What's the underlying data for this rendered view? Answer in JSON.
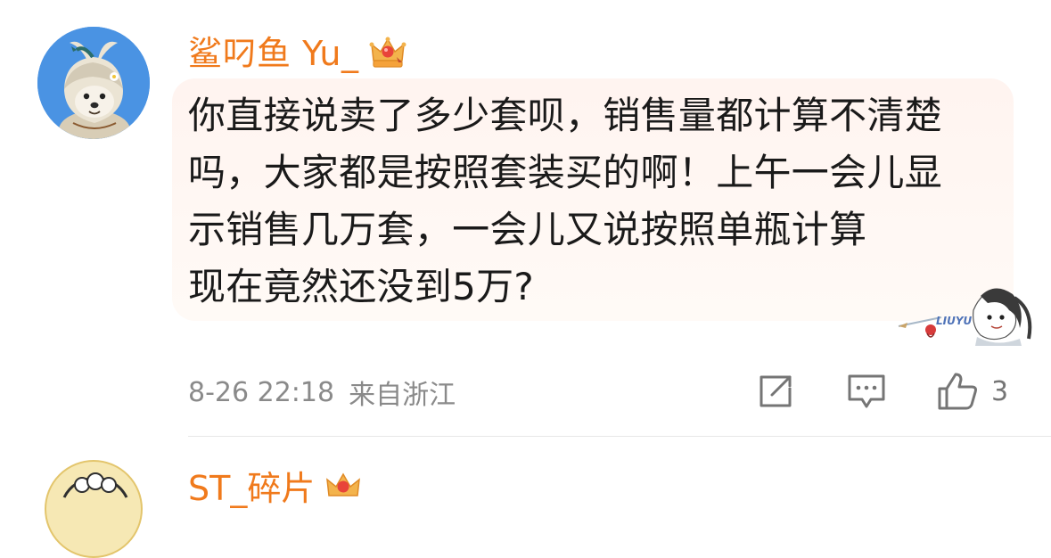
{
  "comment": {
    "username": "鲨叼鱼 Yu_",
    "badge_icon": "crown-icon",
    "text_lines": [
      "你直接说卖了多少套呗，销售量都计算不清楚",
      "吗，大家都是按照套装买的啊！上午一会儿显",
      "示销售几万套，一会儿又说按照单瓶计算",
      "现在竟然还没到5万?"
    ],
    "decoration_label": "LIUYU",
    "date": "8-26 22:18",
    "location": "来自浙江",
    "actions": {
      "share_icon": "share-icon",
      "reply_icon": "reply-icon",
      "like_icon": "thumbs-up-icon",
      "like_count": "3"
    }
  },
  "next_comment": {
    "username": "ST_碎片",
    "badge_icon": "crown-icon"
  },
  "colors": {
    "username": "#f07a1c",
    "body_text": "#1a1a1a",
    "meta_text": "#8a8a8a",
    "bubble_bg": "#fff4f0",
    "avatar_bg": "#4a93e3"
  }
}
